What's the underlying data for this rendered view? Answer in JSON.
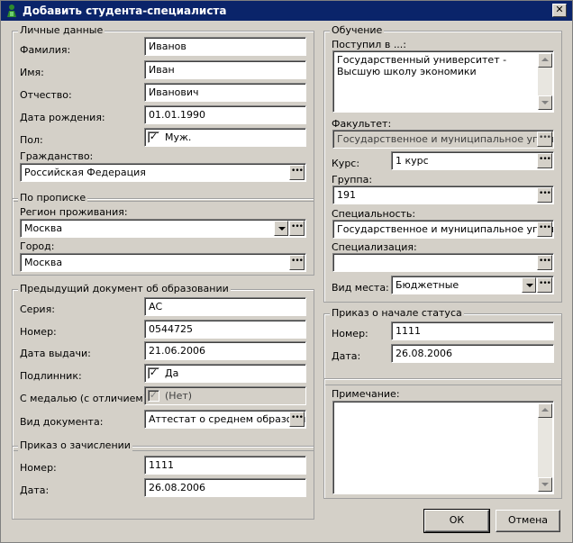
{
  "window": {
    "title": "Добавить студента-специалиста"
  },
  "personal": {
    "legend": "Личные данные",
    "surname_label": "Фамилия:",
    "surname": "Иванов",
    "name_label": "Имя:",
    "name": "Иван",
    "patronymic_label": "Отчество:",
    "patronymic": "Иванович",
    "birthdate_label": "Дата рождения:",
    "birthdate": "01.01.1990",
    "sex_label": "Пол:",
    "sex_check": "✓",
    "sex_value": "Муж.",
    "citizenship_label": "Гражданство:",
    "citizenship": "Российская Федерация"
  },
  "registration": {
    "legend": "По прописке",
    "region_label": "Регион проживания:",
    "region": "Москва",
    "city_label": "Город:",
    "city": "Москва"
  },
  "prev_doc": {
    "legend": "Предыдущий документ об образовании",
    "series_label": "Серия:",
    "series": "АС",
    "number_label": "Номер:",
    "number": "0544725",
    "issue_date_label": "Дата выдачи:",
    "issue_date": "21.06.2006",
    "original_label": "Подлинник:",
    "original_check": "✓",
    "original_value": "Да",
    "medal_label": "С медалью (с отличием):",
    "medal_check": "✓",
    "medal_value": "(Нет)",
    "doc_type_label": "Вид документа:",
    "doc_type": "Аттестат о среднем образован"
  },
  "enrollment": {
    "legend": "Приказ о зачислении",
    "number_label": "Номер:",
    "number": "1111",
    "date_label": "Дата:",
    "date": "26.08.2006"
  },
  "education": {
    "legend": "Обучение",
    "admitted_label": "Поступил в ...:",
    "admitted": "Государственный университет - Высшую школу экономики",
    "faculty_label": "Факультет:",
    "faculty": "Государственное и муниципальное управле",
    "course_label": "Курс:",
    "course": "1 курс",
    "group_label": "Группа:",
    "group": "191",
    "specialty_label": "Специальность:",
    "specialty": "Государственное и муниципальное управле",
    "specialization_label": "Специализация:",
    "specialization": "",
    "place_label": "Вид места:",
    "place": "Бюджетные"
  },
  "status_order": {
    "legend": "Приказ о начале статуса",
    "number_label": "Номер:",
    "number": "1111",
    "date_label": "Дата:",
    "date": "26.08.2006"
  },
  "note": {
    "legend": "Примечание:",
    "text": ""
  },
  "buttons": {
    "ok": "ОК",
    "cancel": "Отмена",
    "ellipsis": "•••",
    "close": "✕"
  }
}
